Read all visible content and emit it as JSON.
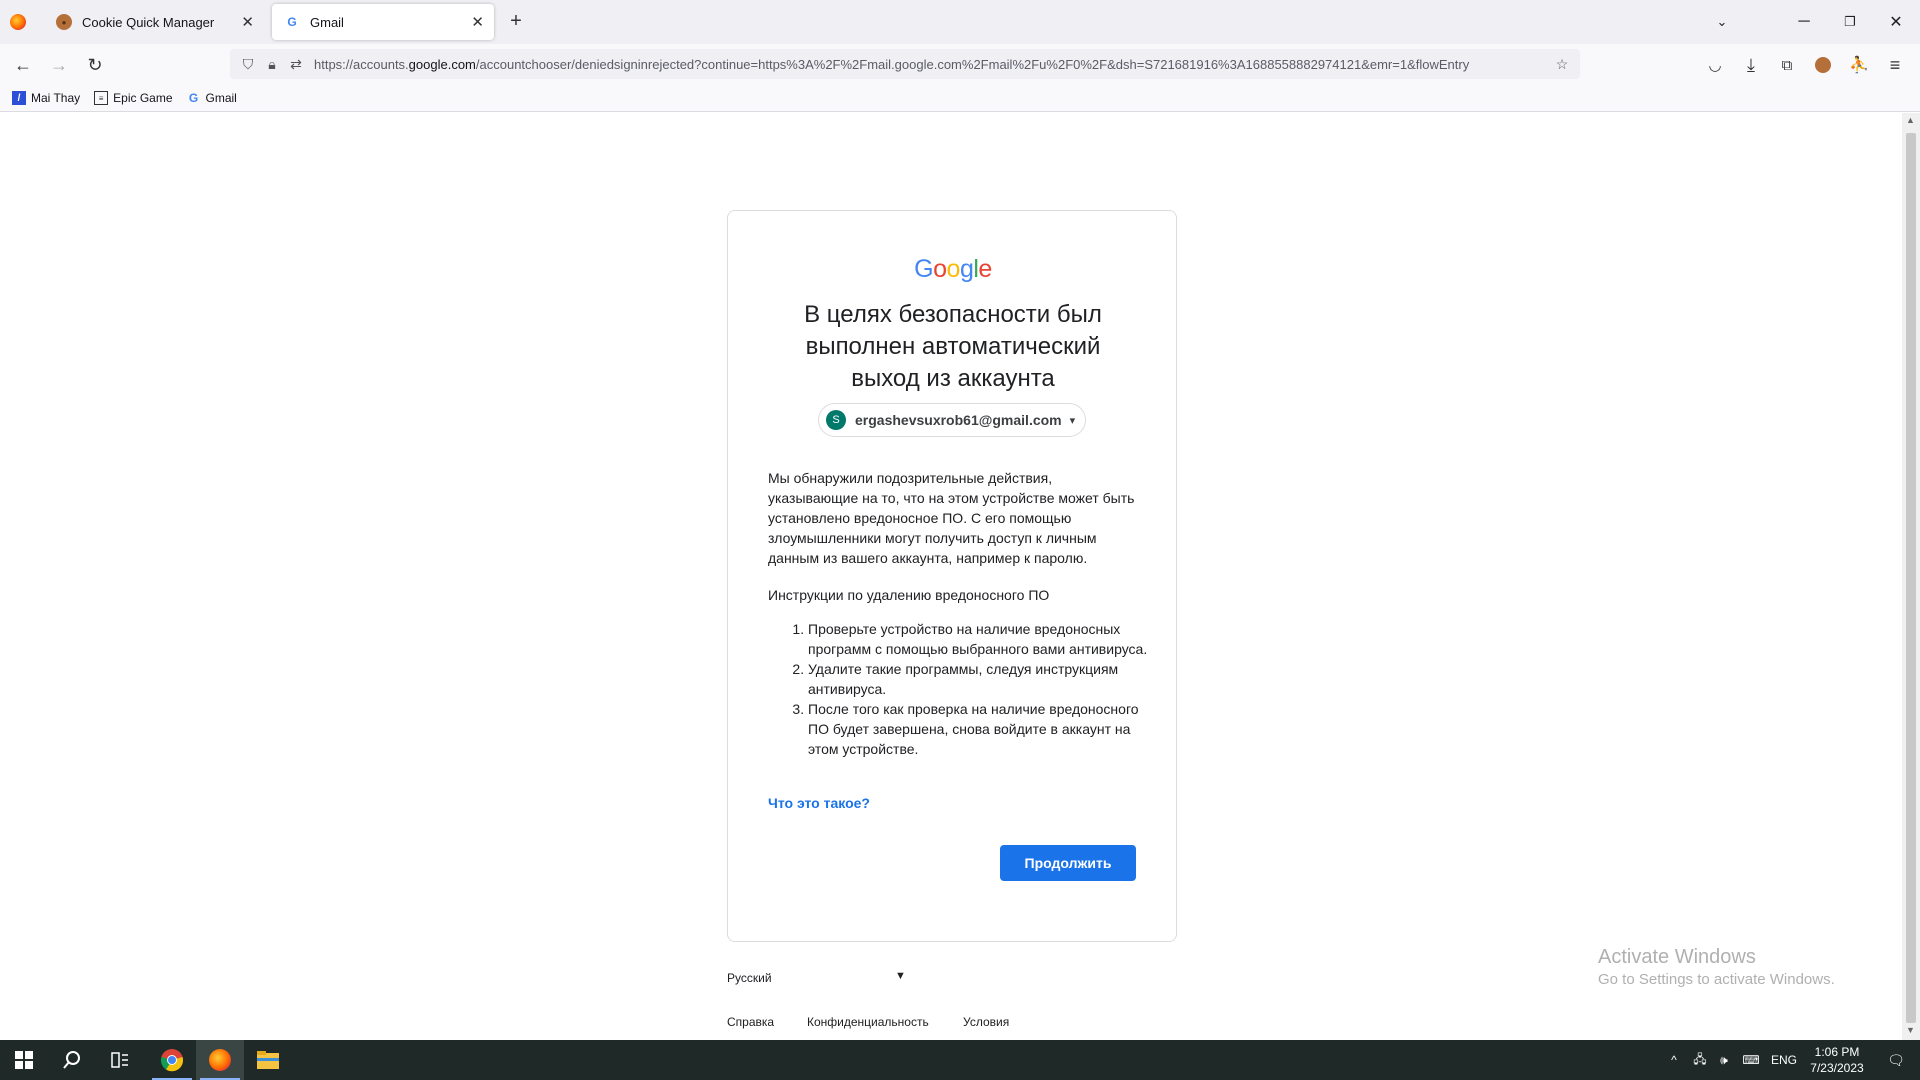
{
  "browser": {
    "tabs": [
      {
        "label": "Cookie Quick Manager",
        "icon": "cookie-icon",
        "active": false
      },
      {
        "label": "Gmail",
        "icon": "google-g-icon",
        "active": true
      }
    ],
    "url_prefix": "https://accounts.",
    "url_domain": "google.com",
    "url_rest": "/accountchooser/deniedsigninrejected?continue=https%3A%2F%2Fmail.google.com%2Fmail%2Fu%2F0%2F&dsh=S721681916%3A1688558882974121&emr=1&flowEntry",
    "bookmarks": [
      {
        "label": "Mai Thay",
        "icon": "slash-bookmark-icon"
      },
      {
        "label": "Epic Game",
        "icon": "doc-bookmark-icon"
      },
      {
        "label": "Gmail",
        "icon": "google-g-icon"
      }
    ]
  },
  "page": {
    "logo": "Google",
    "heading": "В целях безопасности был выполнен автоматический выход из аккаунта",
    "account": {
      "initial": "S",
      "email": "ergashevsuxrob61@gmail.com",
      "avatar_color": "#00796b"
    },
    "body": "Мы обнаружили подозрительные действия, указывающие на то, что на этом устройстве может быть установлено вредоносное ПО. С его помощью злоумышленники могут получить доступ к личным данным из вашего аккаунта, например к паролю.",
    "instructions_title": "Инструкции по удалению вредоносного ПО",
    "steps": [
      "Проверьте устройство на наличие вредоносных программ с помощью выбранного вами антивируса.",
      "Удалите такие программы, следуя инструкциям антивируса.",
      "После того как проверка на наличие вредоносного ПО будет завершена, снова войдите в аккаунт на этом устройстве."
    ],
    "what_link": "Что это такое?",
    "continue_button": "Продолжить",
    "accent_color": "#1a73e8"
  },
  "footer": {
    "language": "Русский",
    "help": "Справка",
    "privacy": "Конфиденциальность",
    "terms": "Условия"
  },
  "watermark": {
    "title": "Activate Windows",
    "subtitle": "Go to Settings to activate Windows."
  },
  "taskbar": {
    "lang": "ENG",
    "time": "1:06 PM",
    "date": "7/23/2023"
  }
}
